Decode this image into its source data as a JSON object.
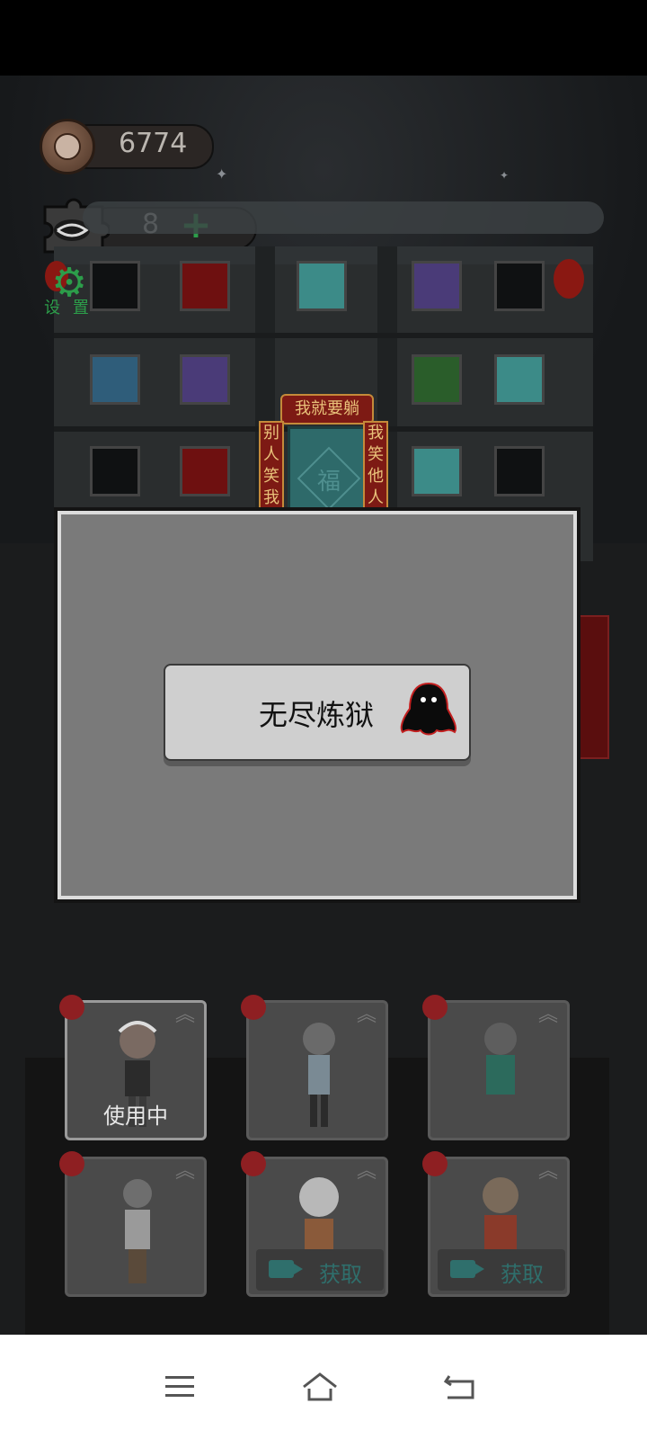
{
  "resources": {
    "coins": "6774",
    "tickets": "8"
  },
  "settings": {
    "label": "设 置"
  },
  "building": {
    "sign": "我就要躺",
    "couplet_left": "别人笑我太",
    "couplet_right": "我笑他人躺",
    "door_char": "福"
  },
  "dialog": {
    "mode_button_label": "无尽炼狱"
  },
  "characters": [
    {
      "status": "使用中",
      "selected": true,
      "action": ""
    },
    {
      "status": "",
      "selected": false,
      "action": ""
    },
    {
      "status": "",
      "selected": false,
      "action": ""
    },
    {
      "status": "",
      "selected": false,
      "action": ""
    },
    {
      "status": "",
      "selected": false,
      "action": "获取"
    },
    {
      "status": "",
      "selected": false,
      "action": "获取"
    }
  ],
  "navbar": {
    "icons": [
      "menu-icon",
      "home-icon",
      "back-icon"
    ]
  },
  "colors": {
    "accent_green": "#2c9d4a",
    "badge_red": "#8e1f22",
    "get_teal": "#2f6f6c"
  }
}
